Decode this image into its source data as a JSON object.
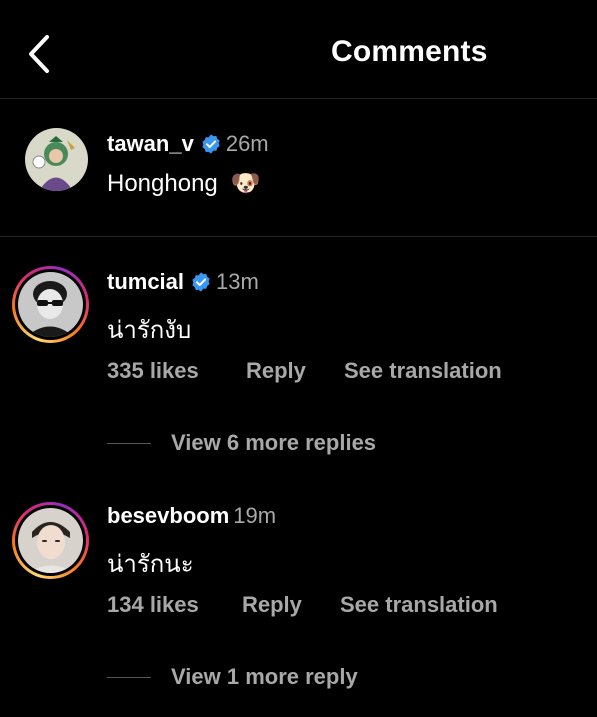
{
  "header": {
    "title": "Comments",
    "back_icon": "chevron-left-icon"
  },
  "caption": {
    "username": "tawan_v",
    "verified": true,
    "time": "26m",
    "text": "Honghong",
    "emoji": "🐶"
  },
  "comments": [
    {
      "username": "tumcial",
      "verified": true,
      "time": "13m",
      "text": "น่ารักงับ",
      "likes": "335 likes",
      "reply": "Reply",
      "translate": "See translation",
      "view_more": "View 6 more replies"
    },
    {
      "username": "besevboom",
      "verified": false,
      "time": "19m",
      "text": "น่ารักนะ",
      "likes": "134 likes",
      "reply": "Reply",
      "translate": "See translation",
      "view_more": "View 1 more reply"
    }
  ],
  "colors": {
    "background": "#000000",
    "text": "#ffffff",
    "secondary": "#a8a8a8",
    "verified": "#3897f0",
    "divider": "#262626"
  }
}
